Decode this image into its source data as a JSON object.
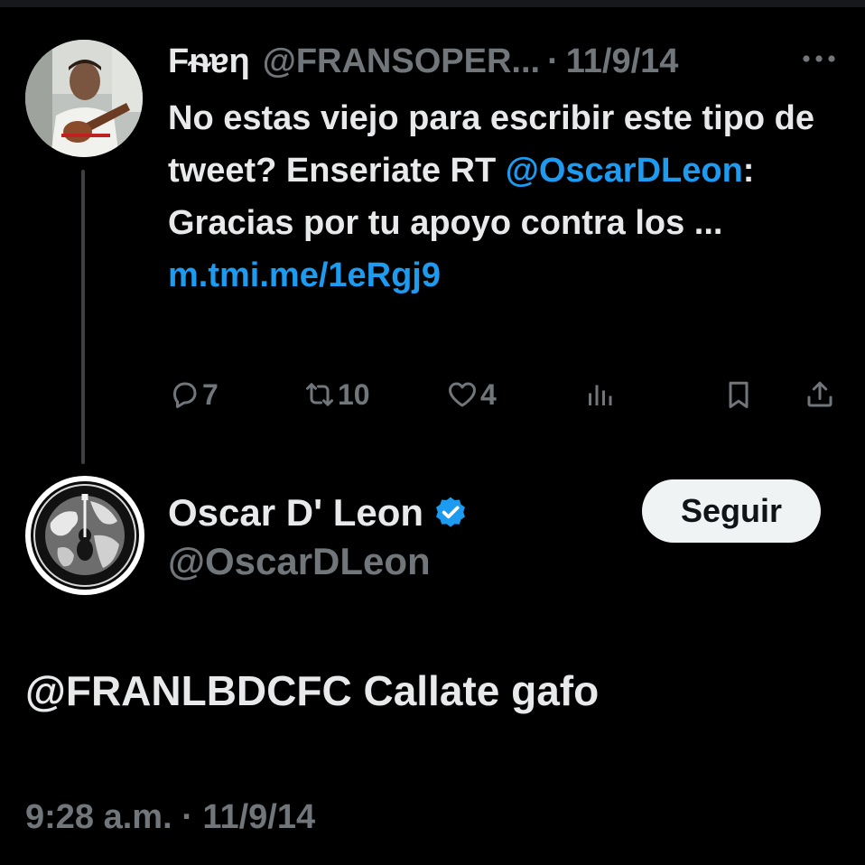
{
  "parent_tweet": {
    "display_name": "Fᵰɐη",
    "handle": "@FRANSOPER...",
    "date_separator": "·",
    "date": "11/9/14",
    "body": {
      "line1": "No estas viejo para escribir este tipo de tweet? Enseriate RT ",
      "mention": "@OscarDLeon",
      "line2": ": Gracias por tu apoyo contra los ... ",
      "link": "m.tmi.me/1eRgj9"
    },
    "stats": {
      "replies": "7",
      "retweets": "10",
      "likes": "4"
    },
    "icons": [
      "reply-icon",
      "retweet-icon",
      "like-icon",
      "views-icon",
      "bookmark-icon",
      "share-icon",
      "more-icon"
    ]
  },
  "main_tweet": {
    "display_name": "Oscar D' Leon",
    "verified": true,
    "handle": "@OscarDLeon",
    "follow_label": "Seguir",
    "body": "@FRANLBDCFC Callate gafo",
    "timestamp": "9:28 a.m. · 11/9/14"
  },
  "colors": {
    "background": "#000000",
    "text": "#e7e9ea",
    "secondary": "#71767b",
    "accent": "#1d9bf0",
    "button_bg": "#eff3f4"
  }
}
